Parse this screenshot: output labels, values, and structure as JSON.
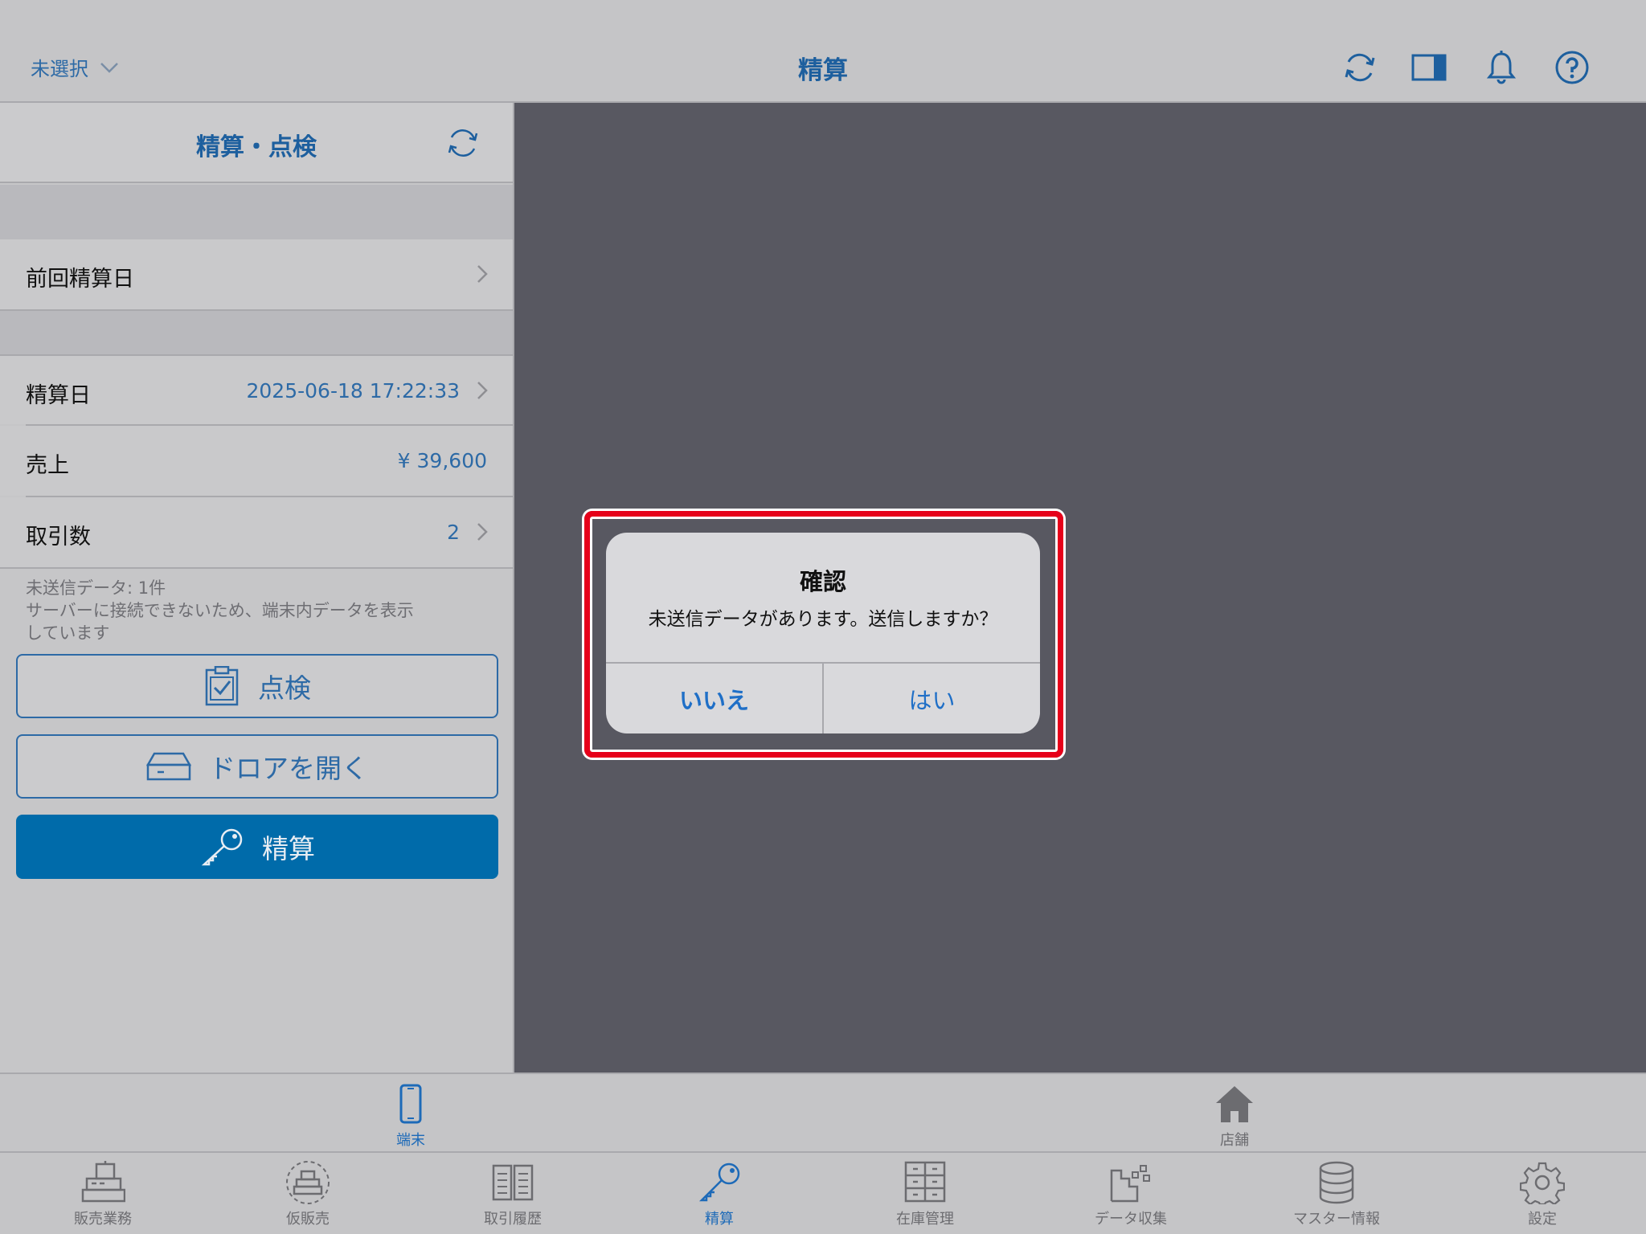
{
  "nav": {
    "store_selector": "未選択",
    "title": "精算"
  },
  "panel": {
    "title": "精算・点検",
    "last_settlement_label": "前回精算日",
    "rows": {
      "settlement_date": {
        "label": "精算日",
        "value": "2025-06-18 17:22:33"
      },
      "sales": {
        "label": "売上",
        "value": "¥ 39,600"
      },
      "transactions": {
        "label": "取引数",
        "value": "2"
      }
    },
    "note_line1": "未送信データ: 1件",
    "note_line2": "サーバーに接続できないため、端末内データを表示",
    "note_line3": "しています",
    "buttons": {
      "inspect": "点検",
      "open_drawer": "ドロアを開く",
      "settle": "精算"
    }
  },
  "alert": {
    "title": "確認",
    "message": "未送信データがあります。送信しますか？",
    "no": "いいえ",
    "yes": "はい"
  },
  "segments": {
    "device": "端末",
    "store": "店舗"
  },
  "tabs": {
    "sales": "販売業務",
    "provisional": "仮販売",
    "history": "取引履歴",
    "settlement": "精算",
    "inventory": "在庫管理",
    "data_collection": "データ収集",
    "master": "マスター情報",
    "settings": "設定"
  },
  "colors": {
    "accent": "#1d5f9e",
    "primary_button": "#006baa",
    "alert_highlight": "#e6001a",
    "dim_overlay": "#585861"
  },
  "active": {
    "segment": "device",
    "tab": "settlement"
  }
}
